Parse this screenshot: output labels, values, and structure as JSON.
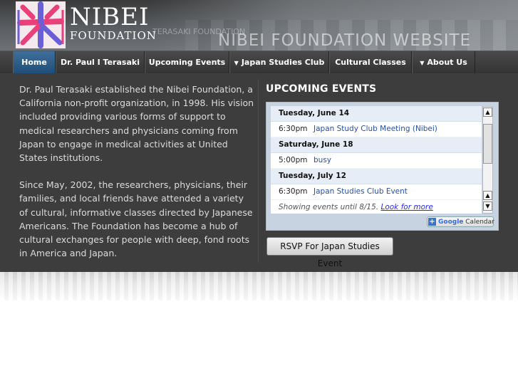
{
  "header": {
    "logo_title": "NIBEI",
    "logo_subtitle": "FOUNDATION",
    "watermark": "NIBEI FOUNDATION WEBSITE",
    "watermark_small": "TERASAKI FOUNDATION"
  },
  "nav": {
    "items": [
      {
        "label": "Home",
        "active": true,
        "dropdown": false
      },
      {
        "label": "Dr. Paul I Terasaki",
        "active": false,
        "dropdown": false
      },
      {
        "label": "Upcoming Events",
        "active": false,
        "dropdown": false
      },
      {
        "label": "Japan Studies Club",
        "active": false,
        "dropdown": true
      },
      {
        "label": "Cultural Classes",
        "active": false,
        "dropdown": false
      },
      {
        "label": "About Us",
        "active": false,
        "dropdown": true
      }
    ]
  },
  "intro": {
    "paragraph1": "Dr. Paul Terasaki established the Nibei Foundation, a California non-profit organization, in 1998. His vision included providing various forms of support to medical researchers and physicians coming from Japan to engage in medical activities at United States institutions.",
    "paragraph2": "Since May, 2002, the researchers, physicians, their families, and local friends have attended a variety of cultural, informative classes directed by Japanese Americans. The Foundation has become a hub of cultural exchanges for people with deep, fond roots in America and Japan."
  },
  "events": {
    "heading": "UPCOMING EVENTS",
    "days": [
      {
        "date": "Tuesday, June 14",
        "items": [
          {
            "time": "6:30pm",
            "title": "Japan Study Club Meeting (Nibei)"
          }
        ]
      },
      {
        "date": "Saturday, June 18",
        "items": [
          {
            "time": "5:00pm",
            "title": "busy"
          }
        ]
      },
      {
        "date": "Tuesday, July 12",
        "items": [
          {
            "time": "6:30pm",
            "title": "Japan Studies Club Event"
          }
        ]
      }
    ],
    "footer_text": "Showing events until 8/15.",
    "footer_link": "Look for more",
    "gcal_label_google": "Google",
    "gcal_label_calendar": "Calendar"
  },
  "rsvp_label": "RSVP For Japan Studies Event",
  "colors": {
    "nav_active": "#1e4d78",
    "main_bg": "#3d3d3d",
    "event_title": "#2a4fa0"
  }
}
